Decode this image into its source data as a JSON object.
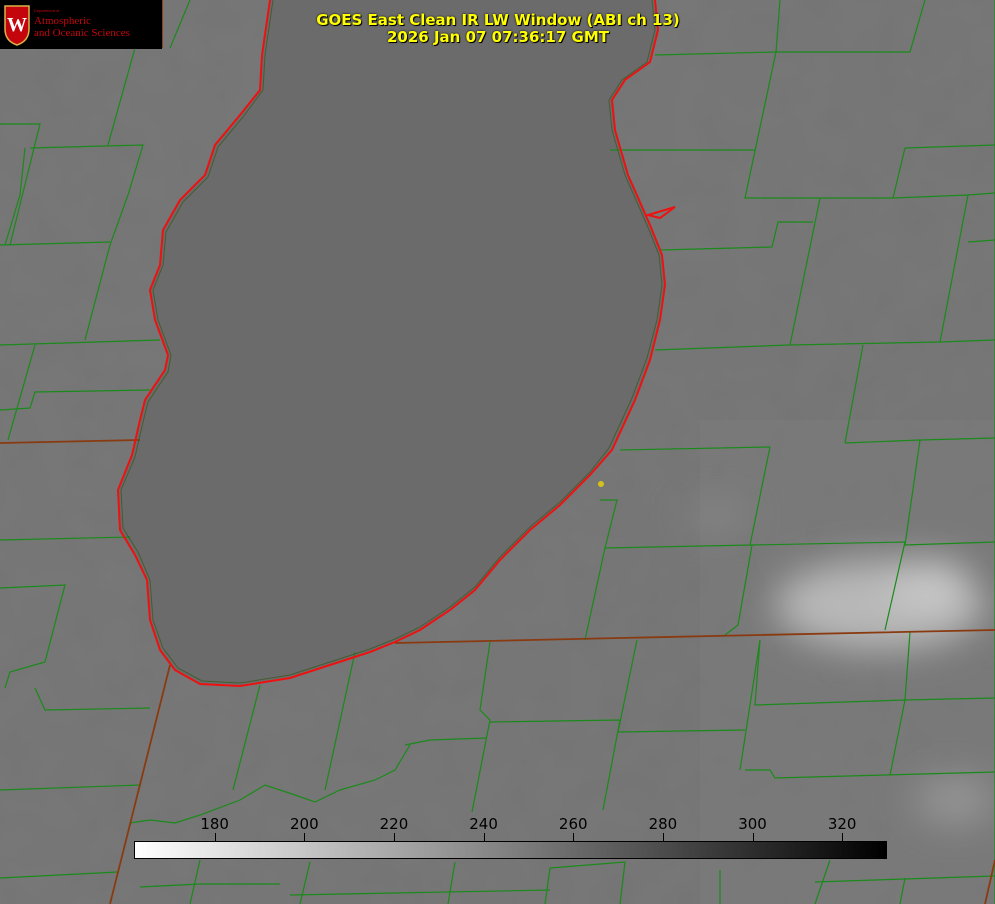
{
  "logo": {
    "department": "Department of",
    "line1": "Atmospheric",
    "line2": "and Oceanic Sciences",
    "crest_letter": "W",
    "color": "#c5050c"
  },
  "title": {
    "line1": "GOES East Clean IR LW Window (ABI ch 13)",
    "line2": "2026 Jan 07 07:36:17 GMT",
    "color": "#ffff00"
  },
  "colorbar": {
    "ticks": [
      "180",
      "200",
      "220",
      "240",
      "260",
      "280",
      "300",
      "320"
    ],
    "range": [
      162,
      330
    ],
    "gradient": [
      "#ffffff",
      "#000000"
    ]
  },
  "overlay_colors": {
    "county_lines": "#1a8a1a",
    "state_lines": "#8a3a10",
    "lake_shoreline": "#ee1111",
    "marker": "#d4c21a"
  }
}
